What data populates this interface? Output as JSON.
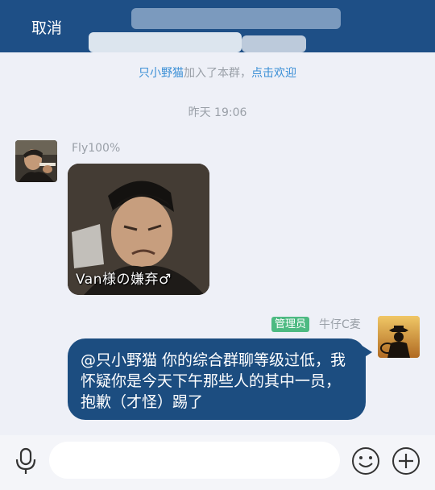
{
  "header": {
    "cancel_label": "取消",
    "background_color": "#1e4f86"
  },
  "system_message": {
    "name": "只小野猫",
    "text": "加入了本群，",
    "welcome_link": "点击欢迎",
    "link_color": "#3b8fd6"
  },
  "timestamp": "昨天 19:06",
  "messages": [
    {
      "side": "left",
      "sender": "Fly100%",
      "type": "sticker",
      "sticker_caption": "Van様の嫌弃♂"
    },
    {
      "side": "right",
      "sender": "牛仔C麦",
      "role_badge": "管理员",
      "role_badge_color": "#4dba82",
      "type": "text",
      "text": "@只小野猫 你的综合群聊等级过低，我怀疑你是今天下午那些人的其中一员，抱歉（才怪）踢了",
      "bubble_color": "#1c4d80"
    }
  ],
  "input_bar": {
    "placeholder": "",
    "mic_icon": "microphone-icon",
    "emoji_icon": "emoji-smile-icon",
    "plus_icon": "plus-circle-icon"
  }
}
